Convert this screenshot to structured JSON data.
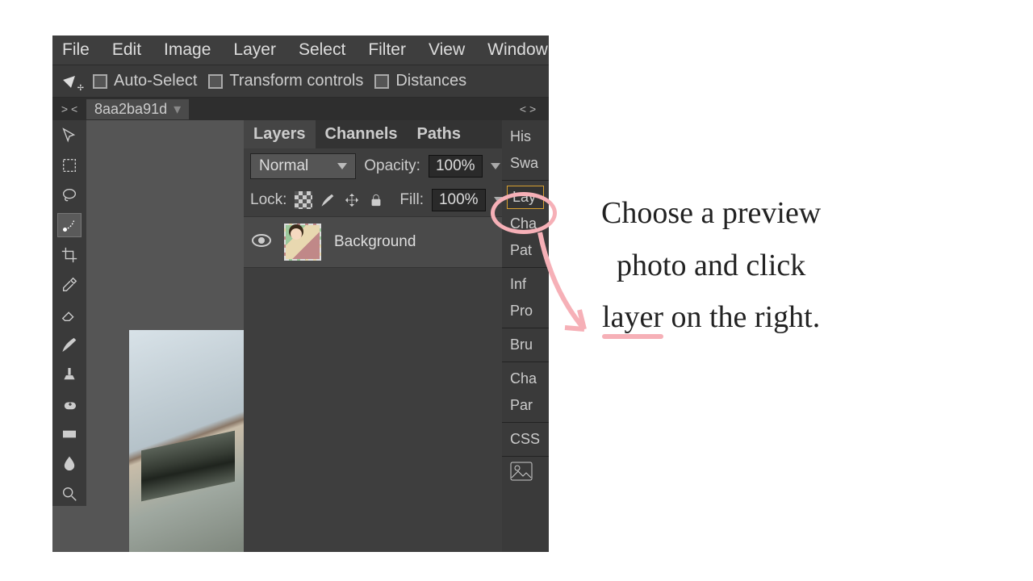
{
  "menu": [
    "File",
    "Edit",
    "Image",
    "Layer",
    "Select",
    "Filter",
    "View",
    "Window"
  ],
  "options": {
    "auto_select": "Auto-Select",
    "transform": "Transform controls",
    "distances": "Distances"
  },
  "doc": {
    "tab_title": "8aa2ba91d",
    "collapse_left": "> <",
    "collapse_right": "< >"
  },
  "layers_panel": {
    "tabs": [
      "Layers",
      "Channels",
      "Paths"
    ],
    "blend_mode": "Normal",
    "opacity_label": "Opacity:",
    "opacity_value": "100%",
    "lock_label": "Lock:",
    "fill_label": "Fill:",
    "fill_value": "100%",
    "items": [
      {
        "name": "Background",
        "visible": true
      }
    ]
  },
  "right_sidebar": {
    "groups": [
      [
        "His",
        "Swa"
      ],
      [
        "Lay",
        "Cha",
        "Pat"
      ],
      [
        "Inf",
        "Pro"
      ],
      [
        "Bru"
      ],
      [
        "Cha",
        "Par"
      ],
      [
        "CSS"
      ]
    ],
    "active": "Lay"
  },
  "annotation": {
    "line1": "Choose a preview",
    "line2": "photo and click",
    "line3_pre": "layer",
    "line3_post": " on the right."
  }
}
